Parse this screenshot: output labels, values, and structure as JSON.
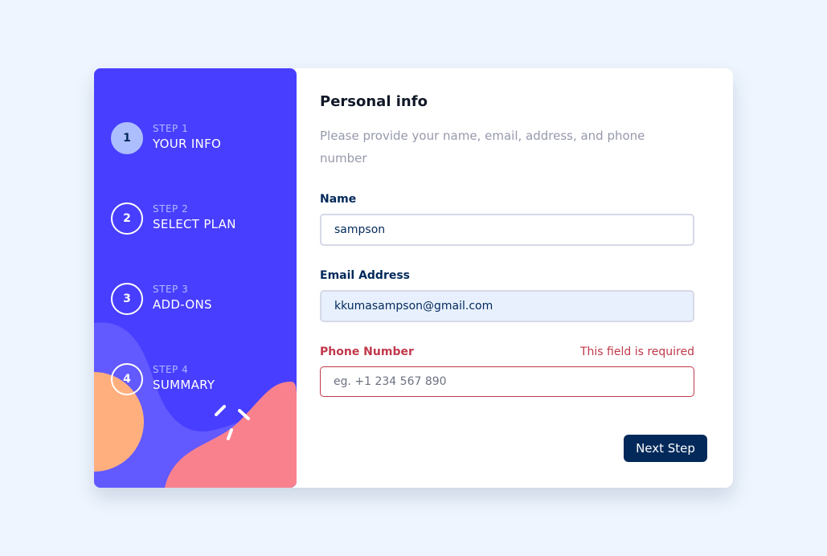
{
  "colors": {
    "sidebar_bg": "#483eff",
    "accent_active_step": "#adbeff",
    "primary_dark": "#02295a",
    "error": "#c0394b",
    "page_bg": "#eef5fe"
  },
  "sidebar": {
    "steps": [
      {
        "number": "1",
        "step_label": "STEP 1",
        "title": "YOUR INFO",
        "active": true
      },
      {
        "number": "2",
        "step_label": "STEP 2",
        "title": "SELECT PLAN",
        "active": false
      },
      {
        "number": "3",
        "step_label": "STEP 3",
        "title": "ADD-ONS",
        "active": false
      },
      {
        "number": "4",
        "step_label": "STEP 4",
        "title": "SUMMARY",
        "active": false
      }
    ]
  },
  "form": {
    "title": "Personal info",
    "subtitle": "Please provide your name, email, address, and phone number",
    "name": {
      "label": "Name",
      "value": "sampson",
      "placeholder": ""
    },
    "email": {
      "label": "Email Address",
      "value": "kkumasampson@gmail.com",
      "placeholder": ""
    },
    "phone": {
      "label": "Phone Number",
      "value": "",
      "placeholder": "eg. +1 234 567 890",
      "error": "This field is required"
    },
    "next_label": "Next Step"
  }
}
